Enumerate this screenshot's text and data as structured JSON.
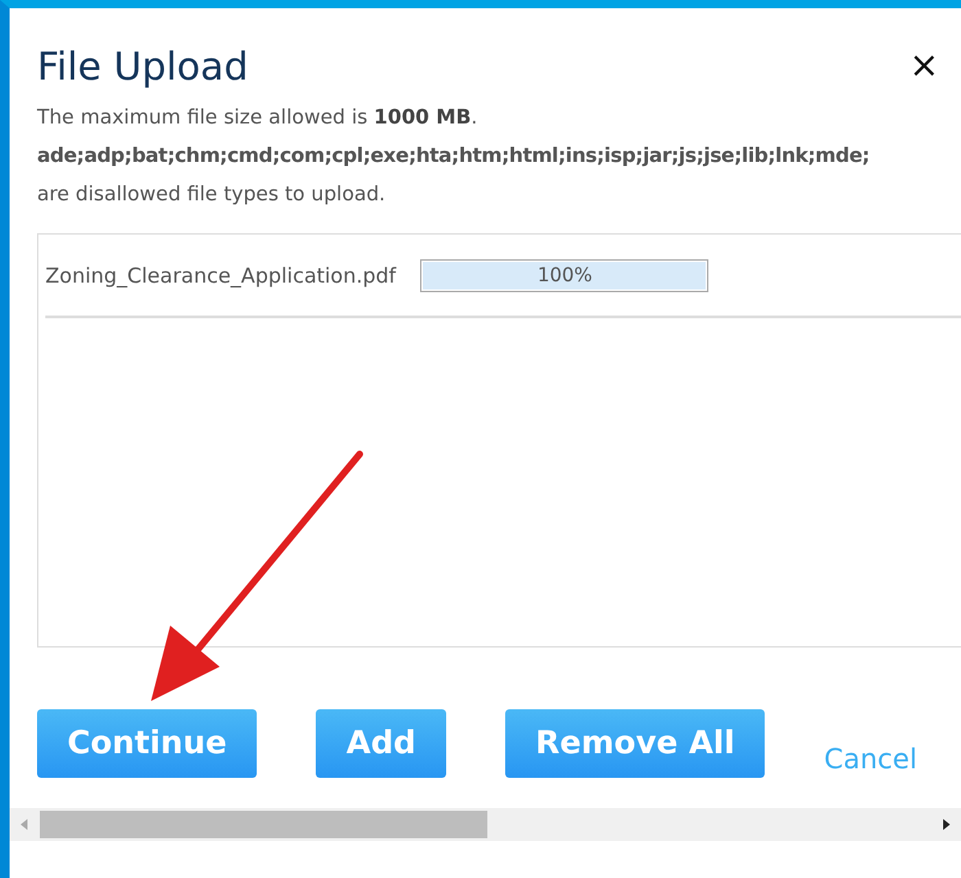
{
  "dialog": {
    "title": "File Upload",
    "close": "×",
    "size_note": "The maximum file size allowed is **1000 MB**.",
    "disallowed_types": "ade;adp;bat;chm;cmd;com;cpl;exe;hta;htm;html;ins;isp;jar;js;jse;lib;lnk;mde;",
    "disallowed_note": "are disallowed file types to upload."
  },
  "files": [
    {
      "name": "Zoning_Clearance_Application.pdf",
      "level": 1,
      "reading": "100%"
    }
  ],
  "buttons": [
    {
      "label": "Continue",
      "kind": "button"
    },
    {
      "label": "Add",
      "kind": "button"
    },
    {
      "label": "Remove All",
      "kind": "button"
    },
    {
      "label": "Cancel",
      "kind": "link"
    }
  ]
}
